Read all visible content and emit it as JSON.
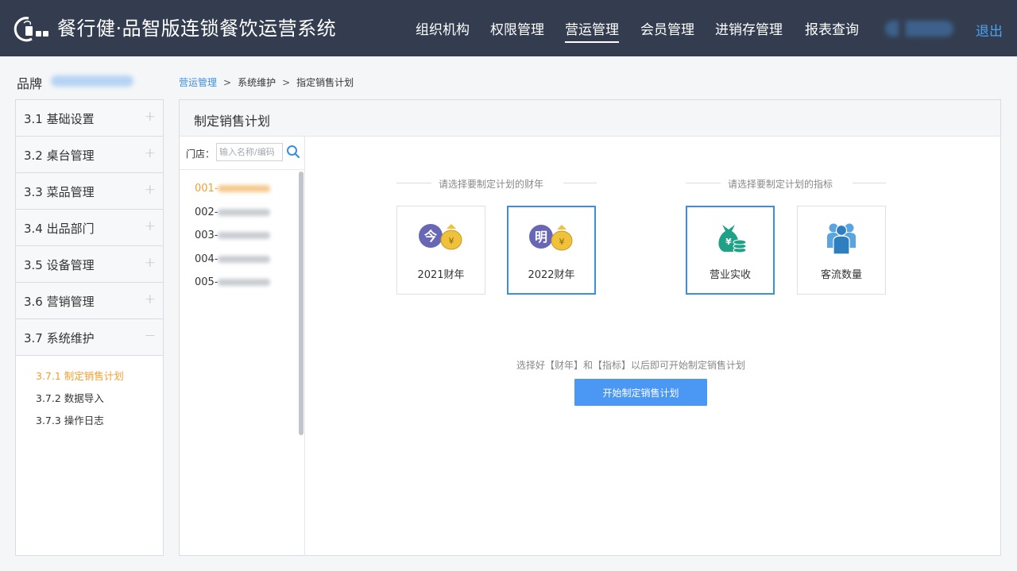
{
  "header": {
    "app_title": "餐行健·品智版连锁餐饮运营系统",
    "nav": [
      {
        "label": "组织机构"
      },
      {
        "label": "权限管理"
      },
      {
        "label": "营运管理",
        "active": true
      },
      {
        "label": "会员管理"
      },
      {
        "label": "进销存管理"
      },
      {
        "label": "报表查询"
      }
    ],
    "logout_label": "退出"
  },
  "brand": {
    "label": "品牌"
  },
  "breadcrumb": {
    "items": [
      "营运管理",
      "系统维护",
      "指定销售计划"
    ],
    "separator": ">"
  },
  "sidebar": {
    "items": [
      {
        "label": "3.1 基础设置",
        "toggle": "+"
      },
      {
        "label": "3.2 桌台管理",
        "toggle": "+"
      },
      {
        "label": "3.3 菜品管理",
        "toggle": "+"
      },
      {
        "label": "3.4 出品部门",
        "toggle": "+"
      },
      {
        "label": "3.5 设备管理",
        "toggle": "+"
      },
      {
        "label": "3.6 营销管理",
        "toggle": "+"
      },
      {
        "label": "3.7 系统维护",
        "toggle": "−",
        "expanded": true
      }
    ],
    "sub_items": [
      {
        "label": "3.7.1 制定销售计划",
        "active": true
      },
      {
        "label": "3.7.2 数据导入"
      },
      {
        "label": "3.7.3 操作日志"
      }
    ]
  },
  "main": {
    "title": "制定销售计划",
    "store_search": {
      "label": "门店：",
      "placeholder": "输入名称/编码"
    },
    "stores": [
      {
        "code": "001-",
        "active": true
      },
      {
        "code": "002-"
      },
      {
        "code": "003-"
      },
      {
        "code": "004-"
      },
      {
        "code": "005-"
      }
    ],
    "year_section": {
      "caption": "请选择要制定计划的财年",
      "cards": [
        {
          "label": "2021财年",
          "badge": "今",
          "selected": false
        },
        {
          "label": "2022财年",
          "badge": "明",
          "selected": true
        }
      ]
    },
    "metric_section": {
      "caption": "请选择要制定计划的指标",
      "cards": [
        {
          "label": "营业实收",
          "icon": "money-bag-icon",
          "selected": true
        },
        {
          "label": "客流数量",
          "icon": "people-icon",
          "selected": false
        }
      ]
    },
    "hint": "选择好【财年】和【指标】以后即可开始制定销售计划",
    "start_button_label": "开始制定销售计划",
    "coin_symbol": "¥"
  },
  "colors": {
    "topbar": "#333d4f",
    "accent_blue": "#4a97f4",
    "active_orange": "#f0a030",
    "icon_teal": "#1ea187",
    "icon_purple": "#6867b6",
    "icon_gold": "#f0c23c"
  }
}
